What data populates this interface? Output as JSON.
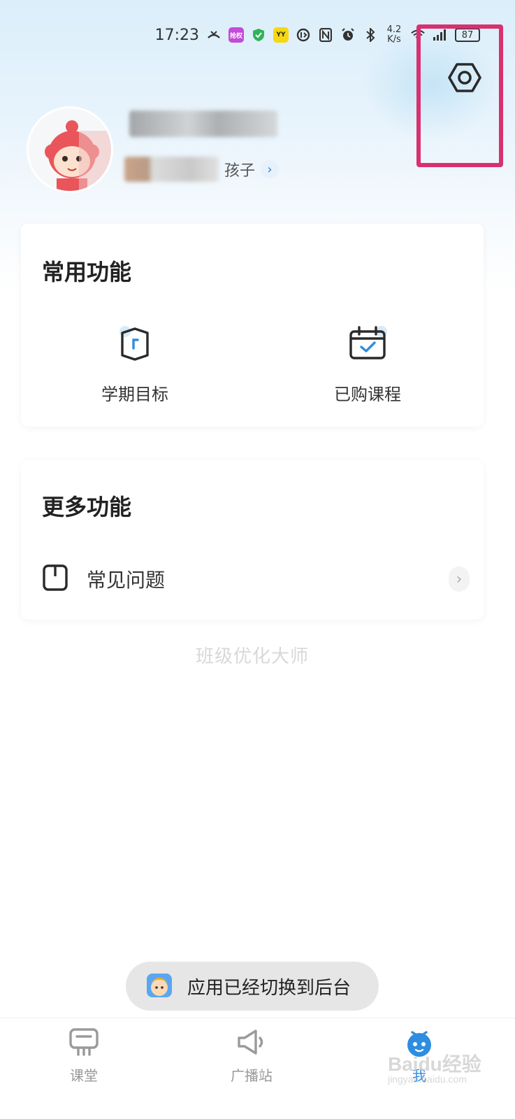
{
  "status_bar": {
    "time": "17:23",
    "speed_value": "4.2",
    "speed_unit": "K/s",
    "battery": "87",
    "pill_1": "抢权",
    "pill_2": "YY"
  },
  "header": {
    "settings_icon": "gear-icon"
  },
  "profile": {
    "sub_text": "孩子"
  },
  "common_functions": {
    "title": "常用功能",
    "items": [
      {
        "label": "学期目标",
        "icon": "target-box-icon"
      },
      {
        "label": "已购课程",
        "icon": "calendar-check-icon"
      }
    ]
  },
  "more_functions": {
    "title": "更多功能",
    "items": [
      {
        "label": "常见问题",
        "icon": "faq-icon"
      }
    ]
  },
  "brand_text": "班级优化大师",
  "toast": {
    "text": "应用已经切换到后台"
  },
  "bottom_nav": {
    "items": [
      {
        "label": "课堂",
        "icon": "classroom-icon",
        "active": false
      },
      {
        "label": "广播站",
        "icon": "megaphone-icon",
        "active": false
      },
      {
        "label": "我",
        "icon": "profile-mascot-icon",
        "active": true
      }
    ]
  },
  "watermark": {
    "brand": "Baidu经验",
    "url": "jingyan.baidu.com"
  },
  "colors": {
    "accent": "#2e8de0",
    "highlight": "#d9306f"
  }
}
